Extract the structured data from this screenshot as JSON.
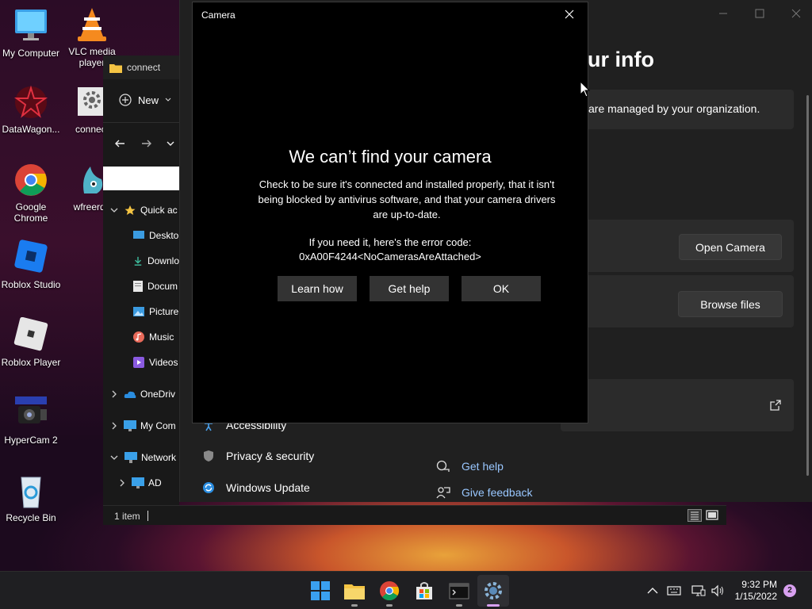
{
  "desktop": {
    "icons": [
      {
        "label": "My Computer"
      },
      {
        "label": "VLC media player"
      },
      {
        "label": "DataWagon..."
      },
      {
        "label": "connect"
      },
      {
        "label": "Google Chrome"
      },
      {
        "label": "wfreerdp"
      },
      {
        "label": "Roblox Studio"
      },
      {
        "label": "Roblox Player"
      },
      {
        "label": "HyperCam 2"
      },
      {
        "label": "Recycle Bin"
      }
    ]
  },
  "explorer": {
    "title": "connect",
    "new_label": "New",
    "tree": [
      {
        "label": "Quick ac"
      },
      {
        "label": "Deskto"
      },
      {
        "label": "Downlo"
      },
      {
        "label": "Docum"
      },
      {
        "label": "Picture"
      },
      {
        "label": "Music"
      },
      {
        "label": "Videos"
      },
      {
        "label": "OneDriv"
      },
      {
        "label": "My Com"
      },
      {
        "label": "Network"
      },
      {
        "label": "AD"
      }
    ],
    "status": "1 item"
  },
  "settings": {
    "heading": "ur info",
    "managed_text": "are managed by your organization.",
    "open_camera": "Open Camera",
    "browse_files": "Browse files",
    "nav": [
      {
        "label": "Accessibility"
      },
      {
        "label": "Privacy & security"
      },
      {
        "label": "Windows Update"
      }
    ],
    "links": [
      {
        "label": "Get help"
      },
      {
        "label": "Give feedback"
      }
    ]
  },
  "camera": {
    "window_title": "Camera",
    "error_title": "We can’t find your camera",
    "error_body": "Check to be sure it's connected and installed properly, that it isn't being blocked by antivirus software, and that your camera drivers are up-to-date.",
    "code_label": "If you need it, here's the error code:",
    "code": "0xA00F4244<NoCamerasAreAttached>",
    "buttons": {
      "learn": "Learn how",
      "help": "Get help",
      "ok": "OK"
    }
  },
  "taskbar": {
    "time": "9:32 PM",
    "date": "1/15/2022",
    "notifications": "2"
  },
  "colors": {
    "accent": "#0078d4",
    "dialog_bg": "#000000",
    "button_bg": "#333333",
    "settings_bg": "#202020"
  }
}
